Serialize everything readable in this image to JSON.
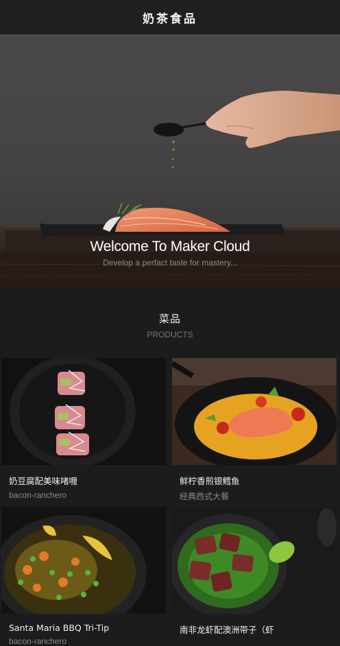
{
  "header": {
    "brand": "奶茶食品"
  },
  "hero": {
    "title": "Welcome To Maker Cloud",
    "subtitle": "Develop a perfact taste for mastery..."
  },
  "section": {
    "title_cn": "菜品",
    "title_en": "PRODUCTS"
  },
  "products": [
    {
      "name": "奶豆腐配美味啫喱",
      "desc": "bacon-ranchero"
    },
    {
      "name": "鲜柠香煎银鳕鱼",
      "desc": "经典西式大餐"
    },
    {
      "name": "Santa Maria BBQ Tri-Tip",
      "desc": "bacon-ranchero"
    },
    {
      "name": "南非龙虾配澳洲带子（虾",
      "desc": ""
    }
  ]
}
